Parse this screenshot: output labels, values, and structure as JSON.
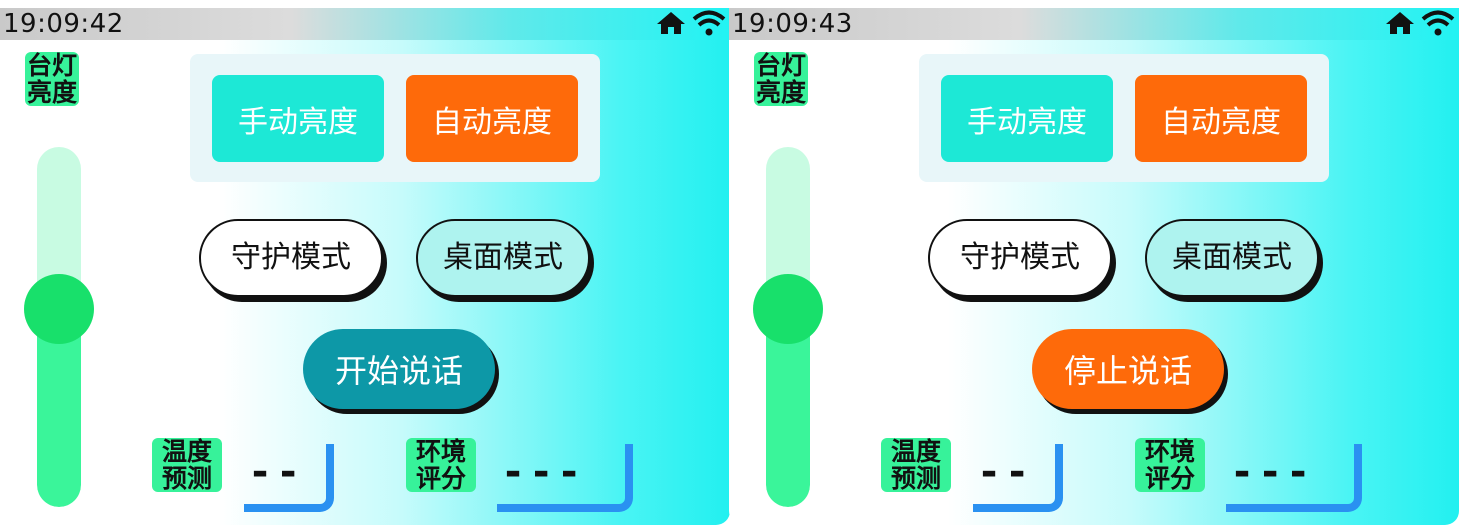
{
  "screens": [
    {
      "clock": "19:09:42",
      "lamp_label": "台灯\n亮度",
      "brightness_level": 0.55,
      "manual_label": "手动亮度",
      "auto_label": "自动亮度",
      "guard_label": "守护模式",
      "desk_label": "桌面模式",
      "talk_label": "开始说话",
      "talk_color": "#0d98a7",
      "temp_label": "温度\n预测",
      "temp_value": "--",
      "env_label": "环境\n评分",
      "env_value": "---"
    },
    {
      "clock": "19:09:43",
      "lamp_label": "台灯\n亮度",
      "brightness_level": 0.55,
      "manual_label": "手动亮度",
      "auto_label": "自动亮度",
      "guard_label": "守护模式",
      "desk_label": "桌面模式",
      "talk_label": "停止说话",
      "talk_color": "#fe6a0a",
      "temp_label": "温度\n预测",
      "temp_value": "--",
      "env_label": "环境\n评分",
      "env_value": "---"
    }
  ],
  "icons": {
    "status": [
      "home-icon",
      "wifi-icon"
    ]
  },
  "colors": {
    "accent_teal": "#1de8d6",
    "accent_orange": "#fe6a0a",
    "slider_green": "#18e06b",
    "box_blue": "#2a91f1"
  }
}
